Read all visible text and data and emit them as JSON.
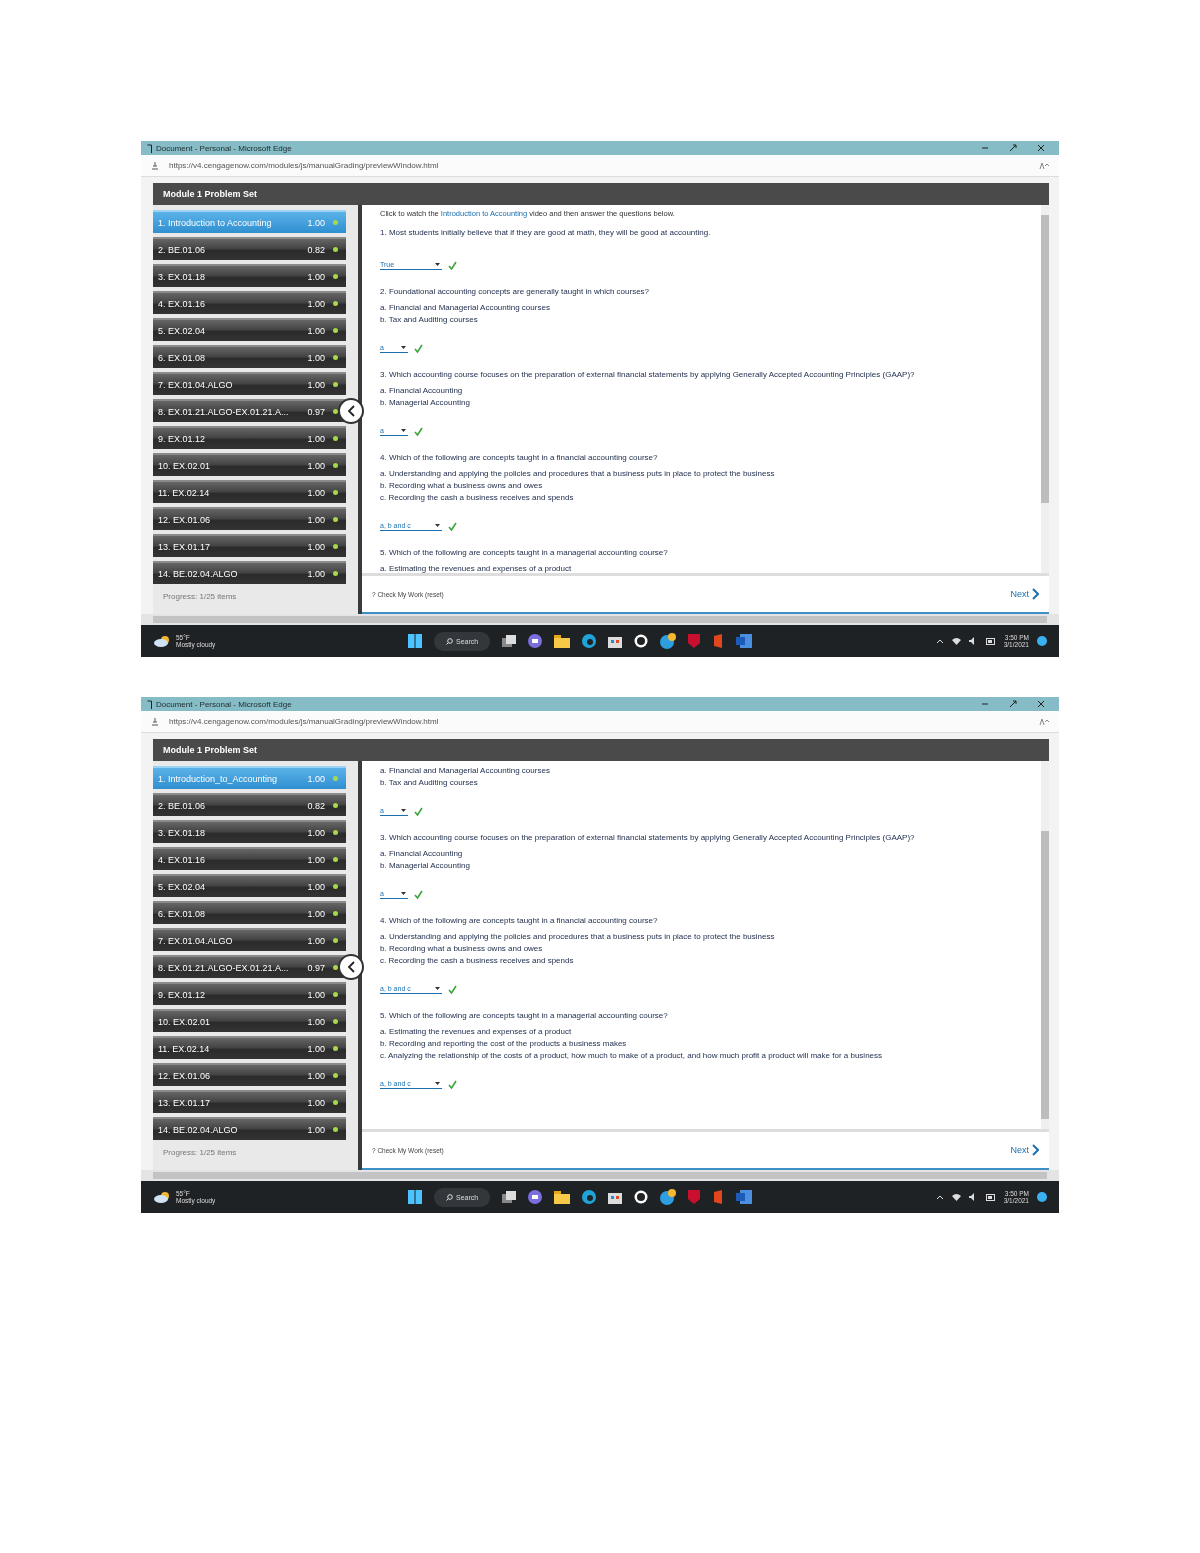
{
  "screenshots": [
    {
      "window": {
        "title": "Document - Personal - Microsoft Edge"
      },
      "address_bar": {
        "url": "https://v4.cengagenow.com/modules/js/manualGrading/previewWindow.html"
      },
      "app": {
        "title": "Module 1 Problem Set",
        "items": [
          {
            "label": "1. Introduction to Accounting",
            "score": "1.00",
            "selected": true
          },
          {
            "label": "2. BE.01.06",
            "score": "0.82",
            "selected": false
          },
          {
            "label": "3. EX.01.18",
            "score": "1.00",
            "selected": false
          },
          {
            "label": "4. EX.01.16",
            "score": "1.00",
            "selected": false
          },
          {
            "label": "5. EX.02.04",
            "score": "1.00",
            "selected": false
          },
          {
            "label": "6. EX.01.08",
            "score": "1.00",
            "selected": false
          },
          {
            "label": "7. EX.01.04.ALGO",
            "score": "1.00",
            "selected": false
          },
          {
            "label": "8. EX.01.21.ALGO-EX.01.21.A...",
            "score": "0.97",
            "selected": false
          },
          {
            "label": "9. EX.01.12",
            "score": "1.00",
            "selected": false
          },
          {
            "label": "10. EX.02.01",
            "score": "1.00",
            "selected": false
          },
          {
            "label": "11. EX.02.14",
            "score": "1.00",
            "selected": false
          },
          {
            "label": "12. EX.01.06",
            "score": "1.00",
            "selected": false
          },
          {
            "label": "13. EX.01.17",
            "score": "1.00",
            "selected": false
          },
          {
            "label": "14. BE.02.04.ALGO",
            "score": "1.00",
            "selected": false
          }
        ],
        "progress": "Progress: 1/25 items",
        "content": [
          {
            "kind": "intro",
            "before": "Click to watch the ",
            "link": "Introduction to Accounting",
            "after": " video and then answer the questions below."
          },
          {
            "kind": "question",
            "text": "1.  Most students initially believe that if they are good at math, they will be good at accounting."
          },
          {
            "kind": "answer",
            "value": "True",
            "correct": true
          },
          {
            "kind": "question",
            "text": "2. Foundational accounting concepts are generally taught in which courses?"
          },
          {
            "kind": "option",
            "text": "a. Financial and Managerial Accounting courses"
          },
          {
            "kind": "option",
            "text": "b. Tax and Auditing courses"
          },
          {
            "kind": "answer",
            "value": "a",
            "correct": true
          },
          {
            "kind": "question",
            "text": "3. Which accounting course focuses on the preparation of external financial statements by applying Generally Accepted Accounting Principles (GAAP)?"
          },
          {
            "kind": "option",
            "text": "a. Financial Accounting"
          },
          {
            "kind": "option",
            "text": "b. Managerial Accounting"
          },
          {
            "kind": "answer",
            "value": "a",
            "correct": true
          },
          {
            "kind": "question",
            "text": "4.  Which of the following are concepts taught in a financial accounting course?"
          },
          {
            "kind": "option",
            "text": "a. Understanding and applying the policies and procedures that a business puts in place to protect the business"
          },
          {
            "kind": "option",
            "text": "b. Recording what a business owns and owes"
          },
          {
            "kind": "option",
            "text": "c. Recording the cash a business receives and spends"
          },
          {
            "kind": "answer",
            "value": "a, b and c",
            "correct": true
          },
          {
            "kind": "question",
            "text": "5.  Which of the following are concepts taught in a managerial accounting course?"
          },
          {
            "kind": "option",
            "text": "a. Estimating the revenues and expenses of a product"
          }
        ],
        "check_work": "? Check My Work (reset)",
        "next": "Next"
      },
      "taskbar": {
        "temperature": "55°F",
        "weather": "Mostly cloudy",
        "search": "Search",
        "time": "3:50 PM",
        "date": "3/1/2021"
      }
    },
    {
      "window": {
        "title": "Document - Personal - Microsoft Edge"
      },
      "address_bar": {
        "url": "https://v4.cengagenow.com/modules/js/manualGrading/previewWindow.html"
      },
      "app": {
        "title": "Module 1 Problem Set",
        "items": [
          {
            "label": "1. Introduction_to_Accounting",
            "score": "1.00",
            "selected": true
          },
          {
            "label": "2. BE.01.06",
            "score": "0.82",
            "selected": false
          },
          {
            "label": "3. EX.01.18",
            "score": "1.00",
            "selected": false
          },
          {
            "label": "4. EX.01.16",
            "score": "1.00",
            "selected": false
          },
          {
            "label": "5. EX.02.04",
            "score": "1.00",
            "selected": false
          },
          {
            "label": "6. EX.01.08",
            "score": "1.00",
            "selected": false
          },
          {
            "label": "7. EX.01.04.ALGO",
            "score": "1.00",
            "selected": false
          },
          {
            "label": "8. EX.01.21.ALGO-EX.01.21.A...",
            "score": "0.97",
            "selected": false
          },
          {
            "label": "9. EX.01.12",
            "score": "1.00",
            "selected": false
          },
          {
            "label": "10. EX.02.01",
            "score": "1.00",
            "selected": false
          },
          {
            "label": "11. EX.02.14",
            "score": "1.00",
            "selected": false
          },
          {
            "label": "12. EX.01.06",
            "score": "1.00",
            "selected": false
          },
          {
            "label": "13. EX.01.17",
            "score": "1.00",
            "selected": false
          },
          {
            "label": "14. BE.02.04.ALGO",
            "score": "1.00",
            "selected": false
          }
        ],
        "progress": "Progress: 1/25 items",
        "content": [
          {
            "kind": "option",
            "text": "a. Financial and Managerial Accounting courses"
          },
          {
            "kind": "option",
            "text": "b. Tax and Auditing courses"
          },
          {
            "kind": "answer",
            "value": "a",
            "correct": true
          },
          {
            "kind": "question",
            "text": "3. Which accounting course focuses on the preparation of external financial statements by applying Generally Accepted Accounting Principles (GAAP)?"
          },
          {
            "kind": "option",
            "text": "a. Financial Accounting"
          },
          {
            "kind": "option",
            "text": "b. Managerial Accounting"
          },
          {
            "kind": "answer",
            "value": "a",
            "correct": true
          },
          {
            "kind": "question",
            "text": "4.  Which of the following are concepts taught in a financial accounting course?"
          },
          {
            "kind": "option",
            "text": "a. Understanding and applying the policies and procedures that a business puts in place to protect the business"
          },
          {
            "kind": "option",
            "text": "b. Recording what a business owns and owes"
          },
          {
            "kind": "option",
            "text": "c. Recording the cash a business receives and spends"
          },
          {
            "kind": "answer",
            "value": "a, b and c",
            "correct": true
          },
          {
            "kind": "question",
            "text": "5.  Which of the following are concepts taught in a managerial accounting course?"
          },
          {
            "kind": "option",
            "text": "a. Estimating the revenues and expenses of a product"
          },
          {
            "kind": "option",
            "text": "b. Recording and reporting the cost of the products a business makes"
          },
          {
            "kind": "option",
            "text": "c. Analyzing the relationship of the costs of a product, how much to make of a product, and how much profit a product will make for a business"
          },
          {
            "kind": "answer",
            "value": "a, b and c",
            "correct": true
          }
        ],
        "check_work": "? Check My Work (reset)",
        "next": "Next"
      },
      "taskbar": {
        "temperature": "55°F",
        "weather": "Mostly cloudy",
        "search": "Search",
        "time": "3:50 PM",
        "date": "3/1/2021"
      }
    }
  ]
}
